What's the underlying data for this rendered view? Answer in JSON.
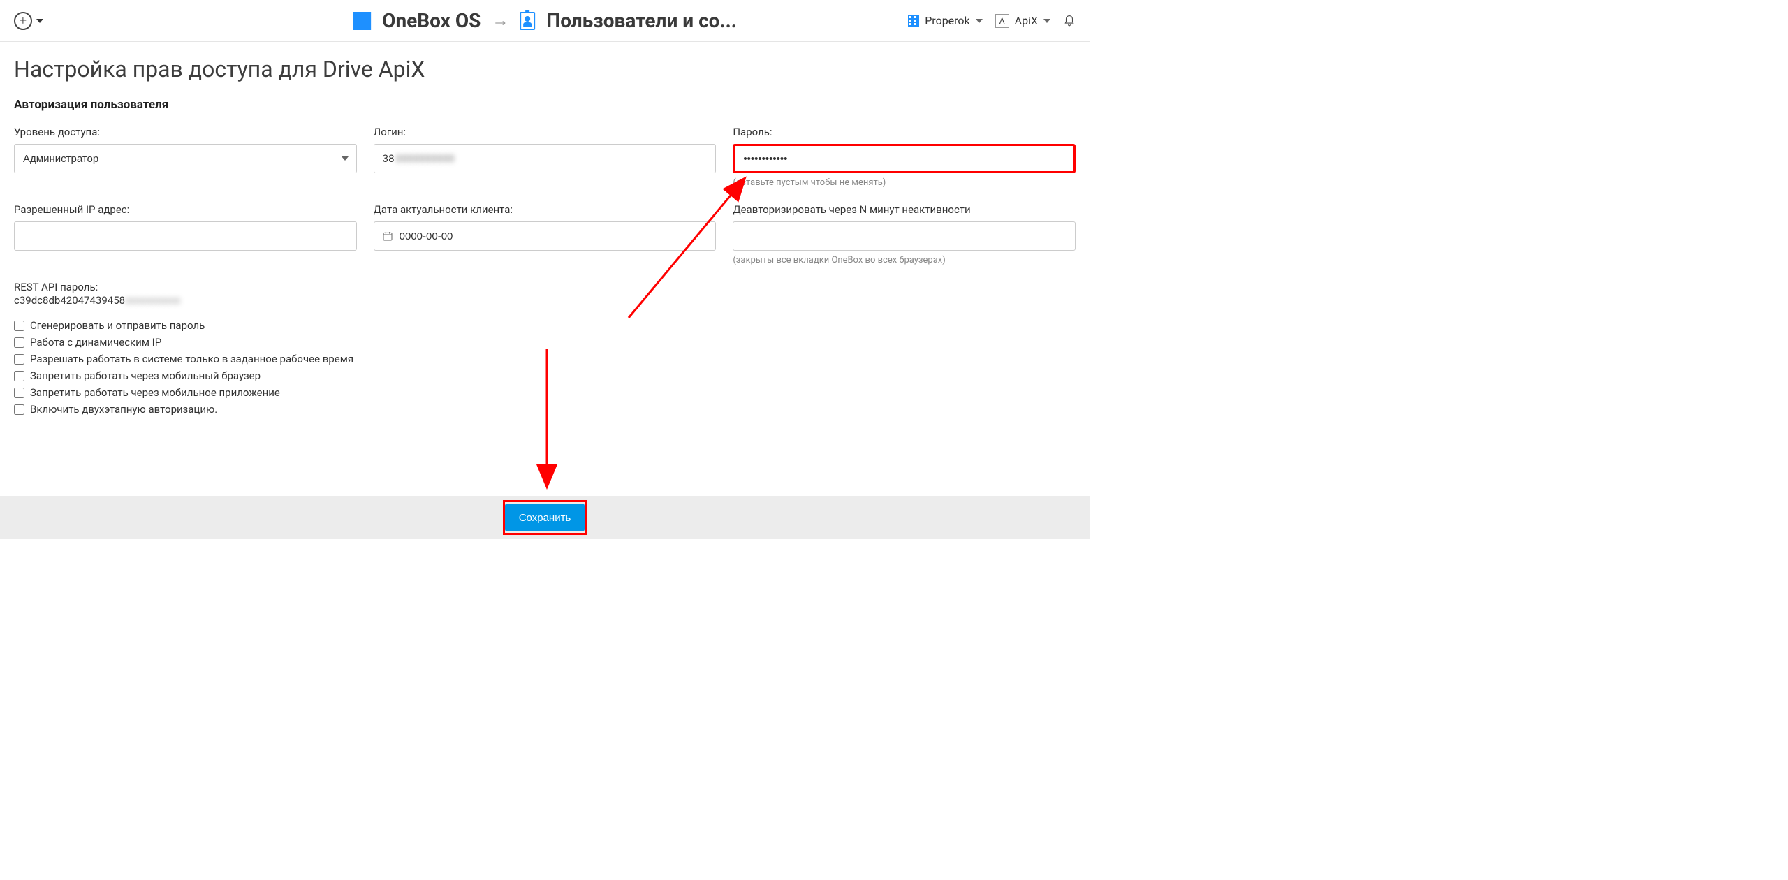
{
  "header": {
    "brand": "OneBox OS",
    "breadcrumb": "Пользователи и со...",
    "org_name": "Properok",
    "user_name": "ApiX",
    "avatar_letter": "A"
  },
  "page": {
    "title": "Настройка прав доступа для Drive ApiX",
    "section_auth": "Авторизация пользователя"
  },
  "fields": {
    "access_level_label": "Уровень доступа:",
    "access_level_value": "Администратор",
    "login_label": "Логин:",
    "login_prefix": "38",
    "login_masked": "0000000000",
    "password_label": "Пароль:",
    "password_value": "••••••••••••",
    "password_hint": "(оставьте пустым чтобы не менять)",
    "allowed_ip_label": "Разрешенный IP адрес:",
    "allowed_ip_value": "",
    "client_date_label": "Дата актуальности клиента:",
    "client_date_value": "0000-00-00",
    "deauth_label": "Деавторизировать через N минут неактивности",
    "deauth_value": "",
    "deauth_hint": "(закрыты все вкладки OneBox во всех браузерах)",
    "rest_api_label": "REST API пароль:",
    "rest_api_visible": "c39dc8db42047439458",
    "rest_api_masked": "xxxxxxxxxx"
  },
  "checkboxes": [
    "Сгенерировать и отправить пароль",
    "Работа с динамическим IP",
    "Разрешать работать в системе только в заданное рабочее время",
    "Запретить работать через мобильный браузер",
    "Запретить работать через мобильное приложение",
    "Включить двухэтапную авторизацию."
  ],
  "footer": {
    "save_label": "Сохранить"
  }
}
